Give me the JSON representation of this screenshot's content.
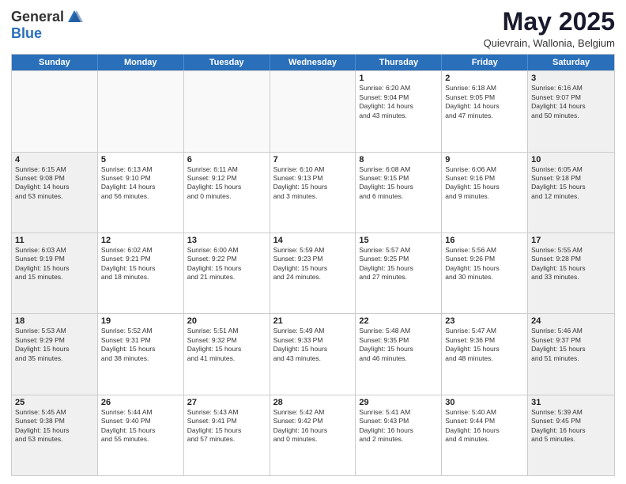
{
  "header": {
    "logo_general": "General",
    "logo_blue": "Blue",
    "month_title": "May 2025",
    "location": "Quievrain, Wallonia, Belgium"
  },
  "days_of_week": [
    "Sunday",
    "Monday",
    "Tuesday",
    "Wednesday",
    "Thursday",
    "Friday",
    "Saturday"
  ],
  "weeks": [
    [
      {
        "day": "",
        "empty": true
      },
      {
        "day": "",
        "empty": true
      },
      {
        "day": "",
        "empty": true
      },
      {
        "day": "",
        "empty": true
      },
      {
        "day": "1",
        "lines": [
          "Sunrise: 6:20 AM",
          "Sunset: 9:04 PM",
          "Daylight: 14 hours",
          "and 43 minutes."
        ]
      },
      {
        "day": "2",
        "lines": [
          "Sunrise: 6:18 AM",
          "Sunset: 9:05 PM",
          "Daylight: 14 hours",
          "and 47 minutes."
        ]
      },
      {
        "day": "3",
        "shaded": true,
        "lines": [
          "Sunrise: 6:16 AM",
          "Sunset: 9:07 PM",
          "Daylight: 14 hours",
          "and 50 minutes."
        ]
      }
    ],
    [
      {
        "day": "4",
        "shaded": true,
        "lines": [
          "Sunrise: 6:15 AM",
          "Sunset: 9:08 PM",
          "Daylight: 14 hours",
          "and 53 minutes."
        ]
      },
      {
        "day": "5",
        "lines": [
          "Sunrise: 6:13 AM",
          "Sunset: 9:10 PM",
          "Daylight: 14 hours",
          "and 56 minutes."
        ]
      },
      {
        "day": "6",
        "lines": [
          "Sunrise: 6:11 AM",
          "Sunset: 9:12 PM",
          "Daylight: 15 hours",
          "and 0 minutes."
        ]
      },
      {
        "day": "7",
        "lines": [
          "Sunrise: 6:10 AM",
          "Sunset: 9:13 PM",
          "Daylight: 15 hours",
          "and 3 minutes."
        ]
      },
      {
        "day": "8",
        "lines": [
          "Sunrise: 6:08 AM",
          "Sunset: 9:15 PM",
          "Daylight: 15 hours",
          "and 6 minutes."
        ]
      },
      {
        "day": "9",
        "lines": [
          "Sunrise: 6:06 AM",
          "Sunset: 9:16 PM",
          "Daylight: 15 hours",
          "and 9 minutes."
        ]
      },
      {
        "day": "10",
        "shaded": true,
        "lines": [
          "Sunrise: 6:05 AM",
          "Sunset: 9:18 PM",
          "Daylight: 15 hours",
          "and 12 minutes."
        ]
      }
    ],
    [
      {
        "day": "11",
        "shaded": true,
        "lines": [
          "Sunrise: 6:03 AM",
          "Sunset: 9:19 PM",
          "Daylight: 15 hours",
          "and 15 minutes."
        ]
      },
      {
        "day": "12",
        "lines": [
          "Sunrise: 6:02 AM",
          "Sunset: 9:21 PM",
          "Daylight: 15 hours",
          "and 18 minutes."
        ]
      },
      {
        "day": "13",
        "lines": [
          "Sunrise: 6:00 AM",
          "Sunset: 9:22 PM",
          "Daylight: 15 hours",
          "and 21 minutes."
        ]
      },
      {
        "day": "14",
        "lines": [
          "Sunrise: 5:59 AM",
          "Sunset: 9:23 PM",
          "Daylight: 15 hours",
          "and 24 minutes."
        ]
      },
      {
        "day": "15",
        "lines": [
          "Sunrise: 5:57 AM",
          "Sunset: 9:25 PM",
          "Daylight: 15 hours",
          "and 27 minutes."
        ]
      },
      {
        "day": "16",
        "lines": [
          "Sunrise: 5:56 AM",
          "Sunset: 9:26 PM",
          "Daylight: 15 hours",
          "and 30 minutes."
        ]
      },
      {
        "day": "17",
        "shaded": true,
        "lines": [
          "Sunrise: 5:55 AM",
          "Sunset: 9:28 PM",
          "Daylight: 15 hours",
          "and 33 minutes."
        ]
      }
    ],
    [
      {
        "day": "18",
        "shaded": true,
        "lines": [
          "Sunrise: 5:53 AM",
          "Sunset: 9:29 PM",
          "Daylight: 15 hours",
          "and 35 minutes."
        ]
      },
      {
        "day": "19",
        "lines": [
          "Sunrise: 5:52 AM",
          "Sunset: 9:31 PM",
          "Daylight: 15 hours",
          "and 38 minutes."
        ]
      },
      {
        "day": "20",
        "lines": [
          "Sunrise: 5:51 AM",
          "Sunset: 9:32 PM",
          "Daylight: 15 hours",
          "and 41 minutes."
        ]
      },
      {
        "day": "21",
        "lines": [
          "Sunrise: 5:49 AM",
          "Sunset: 9:33 PM",
          "Daylight: 15 hours",
          "and 43 minutes."
        ]
      },
      {
        "day": "22",
        "lines": [
          "Sunrise: 5:48 AM",
          "Sunset: 9:35 PM",
          "Daylight: 15 hours",
          "and 46 minutes."
        ]
      },
      {
        "day": "23",
        "lines": [
          "Sunrise: 5:47 AM",
          "Sunset: 9:36 PM",
          "Daylight: 15 hours",
          "and 48 minutes."
        ]
      },
      {
        "day": "24",
        "shaded": true,
        "lines": [
          "Sunrise: 5:46 AM",
          "Sunset: 9:37 PM",
          "Daylight: 15 hours",
          "and 51 minutes."
        ]
      }
    ],
    [
      {
        "day": "25",
        "shaded": true,
        "lines": [
          "Sunrise: 5:45 AM",
          "Sunset: 9:38 PM",
          "Daylight: 15 hours",
          "and 53 minutes."
        ]
      },
      {
        "day": "26",
        "lines": [
          "Sunrise: 5:44 AM",
          "Sunset: 9:40 PM",
          "Daylight: 15 hours",
          "and 55 minutes."
        ]
      },
      {
        "day": "27",
        "lines": [
          "Sunrise: 5:43 AM",
          "Sunset: 9:41 PM",
          "Daylight: 15 hours",
          "and 57 minutes."
        ]
      },
      {
        "day": "28",
        "lines": [
          "Sunrise: 5:42 AM",
          "Sunset: 9:42 PM",
          "Daylight: 16 hours",
          "and 0 minutes."
        ]
      },
      {
        "day": "29",
        "lines": [
          "Sunrise: 5:41 AM",
          "Sunset: 9:43 PM",
          "Daylight: 16 hours",
          "and 2 minutes."
        ]
      },
      {
        "day": "30",
        "lines": [
          "Sunrise: 5:40 AM",
          "Sunset: 9:44 PM",
          "Daylight: 16 hours",
          "and 4 minutes."
        ]
      },
      {
        "day": "31",
        "shaded": true,
        "lines": [
          "Sunrise: 5:39 AM",
          "Sunset: 9:45 PM",
          "Daylight: 16 hours",
          "and 5 minutes."
        ]
      }
    ]
  ]
}
